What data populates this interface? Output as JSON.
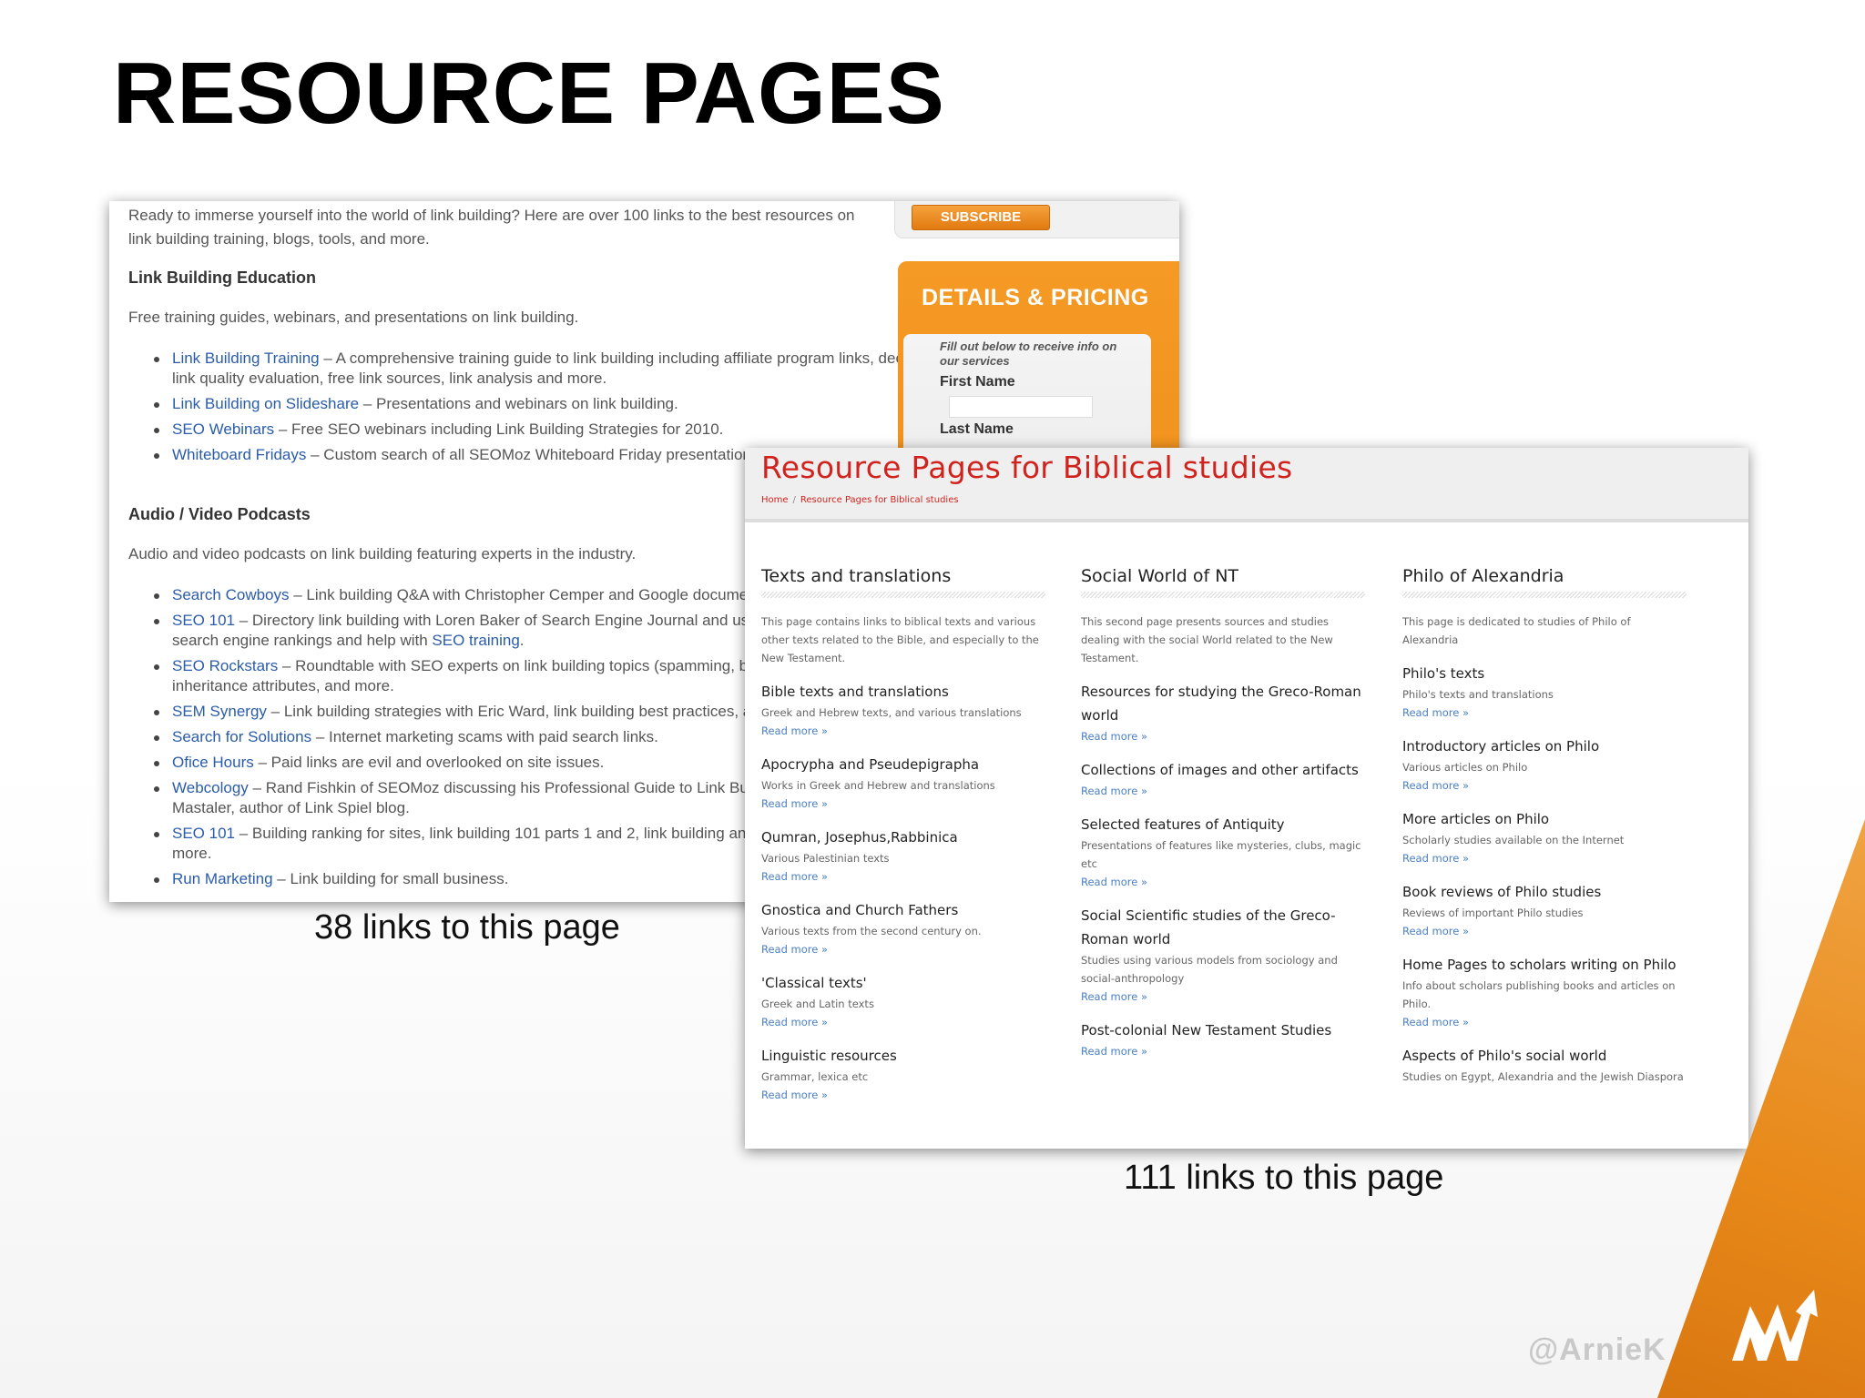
{
  "slide": {
    "title": "RESOURCE PAGES",
    "caption_left": "38 links to this page",
    "caption_right": "111 links to this page",
    "handle": "@ArnieK"
  },
  "shot1": {
    "intro": "Ready to immerse yourself into the world of link building? Here are over 100 links to the best resources on link building training, blogs, tools, and more.",
    "section1": {
      "heading": "Link Building Education",
      "desc": "Free training guides, webinars, and presentations on link building.",
      "items": [
        {
          "link": "Link Building Training",
          "text": " – A comprehensive training guide to link building including affiliate program links, deep linking, link quality evaluation, free link sources, link analysis and more."
        },
        {
          "link": "Link Building on Slideshare",
          "text": " – Presentations and webinars on link building."
        },
        {
          "link": "SEO Webinars",
          "text": " – Free SEO webinars including Link Building Strategies for 2010."
        },
        {
          "link": "Whiteboard Fridays",
          "text": " – Custom search of all SEOMoz Whiteboard Friday presentations about link building."
        }
      ]
    },
    "section2": {
      "heading": "Audio / Video Podcasts",
      "desc": "Audio and video podcasts on link building featuring experts in the industry.",
      "items": [
        {
          "link": "Search Cowboys",
          "text": " – Link building Q&A with Christopher Cemper and Google documentation."
        },
        {
          "link": "SEO 101",
          "text": " – Directory link building with Loren Baker of Search Engine Journal and using link building to improve search engine rankings and help with ",
          "inline_link": "SEO training",
          "after": "."
        },
        {
          "link": "SEO Rockstars",
          "text": " – Roundtable with SEO experts on link building topics (spamming, black hat, white hat), link inheritance attributes, and more."
        },
        {
          "link": "SEM Synergy",
          "text": " – Link building strategies with Eric Ward, link building best practices, and more."
        },
        {
          "link": "Search for Solutions",
          "text": " – Internet marketing scams with paid search links."
        },
        {
          "link": "Ofice Hours",
          "text": " – Paid links are evil and overlooked on site issues."
        },
        {
          "link": "Webcology",
          "text": " – Rand Fishkin of SEOMoz discussing his Professional Guide to Link Building, link building with Debra Mastaler, author of Link Spiel blog."
        },
        {
          "link": "SEO 101",
          "text": " – Building ranking for sites, link building 101 parts 1 and 2, link building and link schemes, nofollow, and more."
        },
        {
          "link": "Run Marketing",
          "text": " – Link building for small business."
        }
      ]
    },
    "sidebar": {
      "subscribe": "SUBSCRIBE",
      "pricing_title": "DETAILS & PRICING",
      "form_note": "Fill out below to receive info on our services",
      "first_name": "First Name",
      "last_name": "Last Name"
    }
  },
  "shot2": {
    "title": "Resource Pages for Biblical studies",
    "breadcrumb": {
      "home": "Home",
      "sep": "/",
      "current": "Resource Pages for Biblical studies"
    },
    "read_more": "Read more »",
    "columns": [
      {
        "heading": "Texts and translations",
        "desc": "This page contains links to biblical texts and various other texts related to the Bible, and especially to the New Testament.",
        "items": [
          {
            "title": "Bible texts and translations",
            "desc": "Greek and Hebrew texts, and various translations"
          },
          {
            "title": "Apocrypha and Pseudepigrapha",
            "desc": "Works in Greek and Hebrew and translations"
          },
          {
            "title": "Qumran, Josephus,Rabbinica",
            "desc": "Various Palestinian texts"
          },
          {
            "title": "Gnostica and Church Fathers",
            "desc": "Various texts from the second century on."
          },
          {
            "title": "'Classical texts'",
            "desc": "Greek and Latin texts"
          },
          {
            "title": "Linguistic resources",
            "desc": "Grammar, lexica etc"
          }
        ]
      },
      {
        "heading": "Social World of NT",
        "desc": "This second page presents sources and studies dealing with the social World related to the New Testament.",
        "items": [
          {
            "title": "Resources for studying the Greco-Roman world",
            "desc": ""
          },
          {
            "title": "Collections of images and other artifacts",
            "desc": ""
          },
          {
            "title": "Selected features of Antiquity",
            "desc": "Presentations of features like mysteries, clubs, magic etc"
          },
          {
            "title": "Social Scientific studies of the Greco-Roman world",
            "desc": "Studies using various models from sociology and social-anthropology"
          },
          {
            "title": "Post-colonial New Testament Studies",
            "desc": ""
          }
        ]
      },
      {
        "heading": "Philo of Alexandria",
        "desc": "This page is dedicated to studies of Philo of Alexandria",
        "items": [
          {
            "title": "Philo's texts",
            "desc": "Philo's texts and translations"
          },
          {
            "title": "Introductory articles on Philo",
            "desc": "Various articles on Philo"
          },
          {
            "title": "More articles on Philo",
            "desc": "Scholarly studies available on the Internet"
          },
          {
            "title": "Book reviews of Philo studies",
            "desc": "Reviews of important Philo studies"
          },
          {
            "title": "Home Pages to scholars writing on Philo",
            "desc": "Info about scholars publishing books and articles on Philo."
          },
          {
            "title": "Aspects of Philo's social world",
            "desc": "Studies on Egypt, Alexandria and the Jewish Diaspora",
            "no_read_more": true
          }
        ]
      }
    ]
  },
  "colors": {
    "accent_orange": "#e8891a",
    "title_red": "#d0231e",
    "link_blue": "#2a5caa"
  },
  "icons": [
    "logo-icon"
  ]
}
